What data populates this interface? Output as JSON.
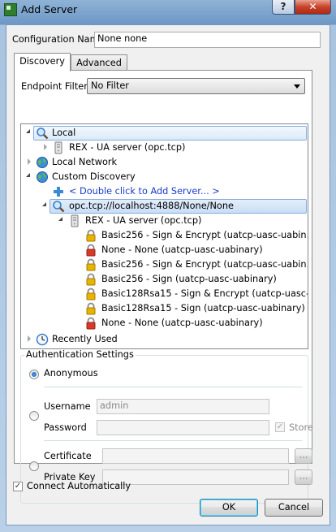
{
  "window": {
    "title": "Add Server",
    "help_label": "?",
    "close_label": "✕"
  },
  "config": {
    "label": "Configuration Name",
    "value": "None none"
  },
  "tabs": [
    {
      "label": "Discovery"
    },
    {
      "label": "Advanced"
    }
  ],
  "filter": {
    "label": "Endpoint Filter:",
    "value": "No Filter"
  },
  "tree": {
    "local": "Local",
    "local_server": "REX - UA server (opc.tcp)",
    "local_network": "Local Network",
    "custom": "Custom Discovery",
    "add_server": "< Double click to Add Server... >",
    "endpoint_url": "opc.tcp://localhost:4888/None/None",
    "custom_server": "REX - UA server (opc.tcp)",
    "endpoints": [
      {
        "label": "Basic256 - Sign & Encrypt (uatcp-uasc-uabin...",
        "secure": true
      },
      {
        "label": "None - None (uatcp-uasc-uabinary)",
        "secure": false
      },
      {
        "label": "Basic256 - Sign & Encrypt (uatcp-uasc-uabin...",
        "secure": true
      },
      {
        "label": "Basic256 - Sign (uatcp-uasc-uabinary)",
        "secure": true
      },
      {
        "label": "Basic128Rsa15 - Sign & Encrypt (uatcp-uasc-...",
        "secure": true
      },
      {
        "label": "Basic128Rsa15 - Sign (uatcp-uasc-uabinary)",
        "secure": true
      },
      {
        "label": "None - None (uatcp-uasc-uabinary)",
        "secure": false
      }
    ],
    "recent": "Recently Used"
  },
  "auth": {
    "title": "Authentication Settings",
    "anonymous": "Anonymous",
    "username_label": "Username",
    "username_value": "admin",
    "password_label": "Password",
    "password_value": "",
    "store_label": "Store",
    "certificate_label": "Certificate",
    "certificate_value": "",
    "private_key_label": "Private Key",
    "private_key_value": "",
    "browse_label": "..."
  },
  "connect": {
    "label": "Connect Automatically",
    "checked": true
  },
  "buttons": {
    "ok": "OK",
    "cancel": "Cancel"
  },
  "colors": {
    "lock_secure": "#e8b400",
    "lock_insecure": "#d83a2a",
    "selection": "#dbeaf9",
    "link": "#1a3cc8"
  }
}
